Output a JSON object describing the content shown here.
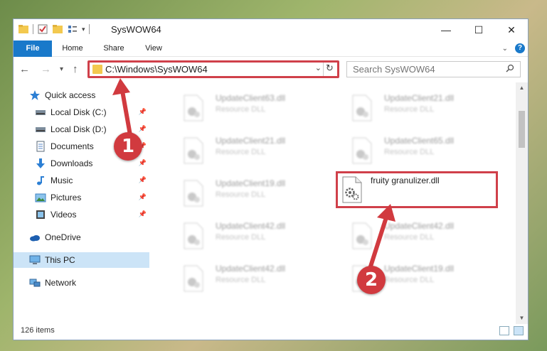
{
  "window": {
    "title": "SysWOW64",
    "minimize": "—",
    "maximize": "☐",
    "close": "✕"
  },
  "ribbon": {
    "tabs": [
      "File",
      "Home",
      "Share",
      "View"
    ],
    "help": "?"
  },
  "navbar": {
    "back": "←",
    "forward": "→",
    "recent": "▾",
    "up": "↑",
    "address": "C:\\Windows\\SysWOW64",
    "address_dropdown": "⌄",
    "refresh": "↻",
    "search_placeholder": "Search SysWOW64"
  },
  "sidebar": {
    "items": [
      {
        "label": "Quick access",
        "icon": "star-icon",
        "pinned": false
      },
      {
        "label": "Local Disk (C:)",
        "icon": "drive-icon",
        "pinned": true
      },
      {
        "label": "Local Disk (D:)",
        "icon": "drive-icon",
        "pinned": true
      },
      {
        "label": "Documents",
        "icon": "documents-icon",
        "pinned": true
      },
      {
        "label": "Downloads",
        "icon": "downloads-icon",
        "pinned": true
      },
      {
        "label": "Music",
        "icon": "music-icon",
        "pinned": true
      },
      {
        "label": "Pictures",
        "icon": "pictures-icon",
        "pinned": true
      },
      {
        "label": "Videos",
        "icon": "videos-icon",
        "pinned": true
      },
      {
        "label": "OneDrive",
        "icon": "cloud-icon",
        "pinned": false
      },
      {
        "label": "This PC",
        "icon": "computer-icon",
        "pinned": false,
        "selected": true
      },
      {
        "label": "Network",
        "icon": "network-icon",
        "pinned": false
      }
    ],
    "pin_glyph": "📌"
  },
  "files": [
    {
      "name": "UpdateClient63.dll",
      "type": "Resource DLL"
    },
    {
      "name": "UpdateClient21.dll",
      "type": "Resource DLL"
    },
    {
      "name": "UpdateClient21.dll",
      "type": "Resource DLL"
    },
    {
      "name": "UpdateClient65.dll",
      "type": "Resource DLL"
    },
    {
      "name": "UpdateClient19.dll",
      "type": "Resource DLL"
    },
    {
      "name": "fruity granulizer.dll",
      "type": "",
      "highlighted": true
    },
    {
      "name": "UpdateClient42.dll",
      "type": "Resource DLL"
    },
    {
      "name": "UpdateClient42.dll",
      "type": "Resource DLL"
    },
    {
      "name": "UpdateClient42.dll",
      "type": "Resource DLL"
    },
    {
      "name": "UpdateClient19.dll",
      "type": "Resource DLL"
    }
  ],
  "status": {
    "item_count": "126 items"
  },
  "annotations": {
    "badge_1": "1",
    "badge_2": "2",
    "color": "#d13a3f"
  },
  "colors": {
    "accent": "#1979ca",
    "highlight": "#d0404a",
    "selected_bg": "#cce4f7"
  }
}
